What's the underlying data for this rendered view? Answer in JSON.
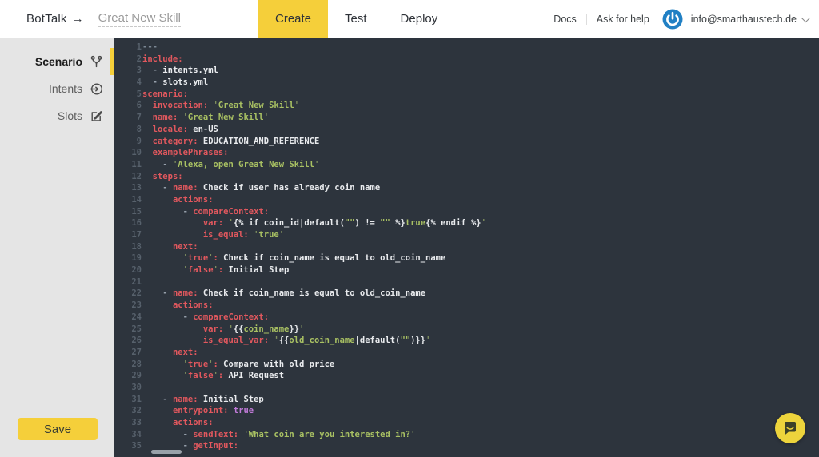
{
  "header": {
    "brand": "BotTalk",
    "brand_arrow": "→",
    "skill_name": "Great New Skill",
    "tabs": [
      {
        "label": "Create",
        "active": true
      },
      {
        "label": "Test",
        "active": false
      },
      {
        "label": "Deploy",
        "active": false
      }
    ],
    "links": {
      "docs": "Docs",
      "help": "Ask for help"
    },
    "account": {
      "email": "info@smarthaustech.de"
    }
  },
  "sidebar": {
    "items": [
      {
        "label": "Scenario",
        "icon": "scenario-branch-icon",
        "active": true
      },
      {
        "label": "Intents",
        "icon": "intents-arrow-icon",
        "active": false
      },
      {
        "label": "Slots",
        "icon": "slots-edit-icon",
        "active": false
      }
    ],
    "save_label": "Save"
  },
  "colors": {
    "accent_yellow": "#f5cf3a",
    "logo_blue": "#2180c4",
    "sidebar_gray": "#e5e5e5",
    "editor_background": "#2d343d",
    "syntax_key": "#e2585e",
    "syntax_string": "#a9c163",
    "syntax_plain": "#e9ebee",
    "syntax_bool": "#c07ad8",
    "line_number": "#57616c"
  },
  "editor": {
    "language": "yaml",
    "lines": [
      {
        "n": 1,
        "tokens": [
          [
            "c",
            "---"
          ]
        ]
      },
      {
        "n": 2,
        "tokens": [
          [
            "k",
            "include:"
          ]
        ]
      },
      {
        "n": 3,
        "tokens": [
          [
            "d",
            "  - "
          ],
          [
            "w",
            "intents.yml"
          ]
        ]
      },
      {
        "n": 4,
        "tokens": [
          [
            "d",
            "  - "
          ],
          [
            "w",
            "slots.yml"
          ]
        ]
      },
      {
        "n": 5,
        "tokens": [
          [
            "k",
            "scenario:"
          ]
        ]
      },
      {
        "n": 6,
        "tokens": [
          [
            "w",
            "  "
          ],
          [
            "k",
            "invocation:"
          ],
          [
            "w",
            " "
          ],
          [
            "q",
            "'"
          ],
          [
            "s",
            "Great New Skill"
          ],
          [
            "q",
            "'"
          ]
        ]
      },
      {
        "n": 7,
        "tokens": [
          [
            "w",
            "  "
          ],
          [
            "k",
            "name:"
          ],
          [
            "w",
            " "
          ],
          [
            "q",
            "'"
          ],
          [
            "s",
            "Great New Skill"
          ],
          [
            "q",
            "'"
          ]
        ]
      },
      {
        "n": 8,
        "tokens": [
          [
            "w",
            "  "
          ],
          [
            "k",
            "locale:"
          ],
          [
            "w",
            " en-US"
          ]
        ]
      },
      {
        "n": 9,
        "tokens": [
          [
            "w",
            "  "
          ],
          [
            "k",
            "category:"
          ],
          [
            "w",
            " EDUCATION_AND_REFERENCE"
          ]
        ]
      },
      {
        "n": 10,
        "tokens": [
          [
            "w",
            "  "
          ],
          [
            "k",
            "examplePhrases:"
          ]
        ]
      },
      {
        "n": 11,
        "tokens": [
          [
            "w",
            "    "
          ],
          [
            "d",
            "- "
          ],
          [
            "q",
            "'"
          ],
          [
            "s",
            "Alexa, open Great New Skill"
          ],
          [
            "q",
            "'"
          ]
        ]
      },
      {
        "n": 12,
        "tokens": [
          [
            "w",
            "  "
          ],
          [
            "k",
            "steps:"
          ]
        ]
      },
      {
        "n": 13,
        "tokens": [
          [
            "w",
            "    "
          ],
          [
            "d",
            "- "
          ],
          [
            "k",
            "name:"
          ],
          [
            "w",
            " Check if user has already coin name"
          ]
        ]
      },
      {
        "n": 14,
        "tokens": [
          [
            "w",
            "      "
          ],
          [
            "k",
            "actions:"
          ]
        ]
      },
      {
        "n": 15,
        "tokens": [
          [
            "w",
            "        "
          ],
          [
            "d",
            "- "
          ],
          [
            "k",
            "compareContext:"
          ]
        ]
      },
      {
        "n": 16,
        "tokens": [
          [
            "w",
            "            "
          ],
          [
            "k",
            "var:"
          ],
          [
            "w",
            " "
          ],
          [
            "q",
            "'"
          ],
          [
            "w",
            "{% if coin_id|default("
          ],
          [
            "s",
            "\"\""
          ],
          [
            "w",
            ") != "
          ],
          [
            "s",
            "\"\""
          ],
          [
            "w",
            " %}"
          ],
          [
            "s",
            "true"
          ],
          [
            "w",
            "{% endif %}"
          ],
          [
            "q",
            "'"
          ]
        ]
      },
      {
        "n": 17,
        "tokens": [
          [
            "w",
            "            "
          ],
          [
            "k",
            "is_equal:"
          ],
          [
            "w",
            " "
          ],
          [
            "q",
            "'"
          ],
          [
            "s",
            "true"
          ],
          [
            "q",
            "'"
          ]
        ]
      },
      {
        "n": 18,
        "tokens": [
          [
            "w",
            "      "
          ],
          [
            "k",
            "next:"
          ]
        ]
      },
      {
        "n": 19,
        "tokens": [
          [
            "w",
            "        "
          ],
          [
            "q",
            "'"
          ],
          [
            "k",
            "true"
          ],
          [
            "q",
            "'"
          ],
          [
            "k",
            ":"
          ],
          [
            "w",
            " Check if coin_name is equal to old_coin_name"
          ]
        ]
      },
      {
        "n": 20,
        "tokens": [
          [
            "w",
            "        "
          ],
          [
            "q",
            "'"
          ],
          [
            "k",
            "false"
          ],
          [
            "q",
            "'"
          ],
          [
            "k",
            ":"
          ],
          [
            "w",
            " Initial Step"
          ]
        ]
      },
      {
        "n": 21,
        "tokens": []
      },
      {
        "n": 22,
        "tokens": [
          [
            "w",
            "    "
          ],
          [
            "d",
            "- "
          ],
          [
            "k",
            "name:"
          ],
          [
            "w",
            " Check if coin_name is equal to old_coin_name"
          ]
        ]
      },
      {
        "n": 23,
        "tokens": [
          [
            "w",
            "      "
          ],
          [
            "k",
            "actions:"
          ]
        ]
      },
      {
        "n": 24,
        "tokens": [
          [
            "w",
            "        "
          ],
          [
            "d",
            "- "
          ],
          [
            "k",
            "compareContext:"
          ]
        ]
      },
      {
        "n": 25,
        "tokens": [
          [
            "w",
            "            "
          ],
          [
            "k",
            "var:"
          ],
          [
            "w",
            " "
          ],
          [
            "q",
            "'"
          ],
          [
            "w",
            "{{"
          ],
          [
            "s",
            "coin_name"
          ],
          [
            "w",
            "}}"
          ],
          [
            "q",
            "'"
          ]
        ]
      },
      {
        "n": 26,
        "tokens": [
          [
            "w",
            "            "
          ],
          [
            "k",
            "is_equal_var:"
          ],
          [
            "w",
            " "
          ],
          [
            "q",
            "'"
          ],
          [
            "w",
            "{{"
          ],
          [
            "s",
            "old_coin_name"
          ],
          [
            "w",
            "|default("
          ],
          [
            "s",
            "\"\""
          ],
          [
            "w",
            ")}}"
          ],
          [
            "q",
            "'"
          ]
        ]
      },
      {
        "n": 27,
        "tokens": [
          [
            "w",
            "      "
          ],
          [
            "k",
            "next:"
          ]
        ]
      },
      {
        "n": 28,
        "tokens": [
          [
            "w",
            "        "
          ],
          [
            "q",
            "'"
          ],
          [
            "k",
            "true"
          ],
          [
            "q",
            "'"
          ],
          [
            "k",
            ":"
          ],
          [
            "w",
            " Compare with old price"
          ]
        ]
      },
      {
        "n": 29,
        "tokens": [
          [
            "w",
            "        "
          ],
          [
            "q",
            "'"
          ],
          [
            "k",
            "false"
          ],
          [
            "q",
            "'"
          ],
          [
            "k",
            ":"
          ],
          [
            "w",
            " API Request"
          ]
        ]
      },
      {
        "n": 30,
        "tokens": []
      },
      {
        "n": 31,
        "tokens": [
          [
            "w",
            "    "
          ],
          [
            "d",
            "- "
          ],
          [
            "k",
            "name:"
          ],
          [
            "w",
            " Initial Step"
          ]
        ]
      },
      {
        "n": 32,
        "tokens": [
          [
            "w",
            "      "
          ],
          [
            "k",
            "entrypoint:"
          ],
          [
            "w",
            " "
          ],
          [
            "b",
            "true"
          ]
        ]
      },
      {
        "n": 33,
        "tokens": [
          [
            "w",
            "      "
          ],
          [
            "k",
            "actions:"
          ]
        ]
      },
      {
        "n": 34,
        "tokens": [
          [
            "w",
            "        "
          ],
          [
            "d",
            "- "
          ],
          [
            "k",
            "sendText:"
          ],
          [
            "w",
            " "
          ],
          [
            "q",
            "'"
          ],
          [
            "s",
            "What coin are you interested in?"
          ],
          [
            "q",
            "'"
          ]
        ]
      },
      {
        "n": 35,
        "tokens": [
          [
            "w",
            "        "
          ],
          [
            "d",
            "- "
          ],
          [
            "k",
            "getInput:"
          ]
        ]
      }
    ]
  }
}
